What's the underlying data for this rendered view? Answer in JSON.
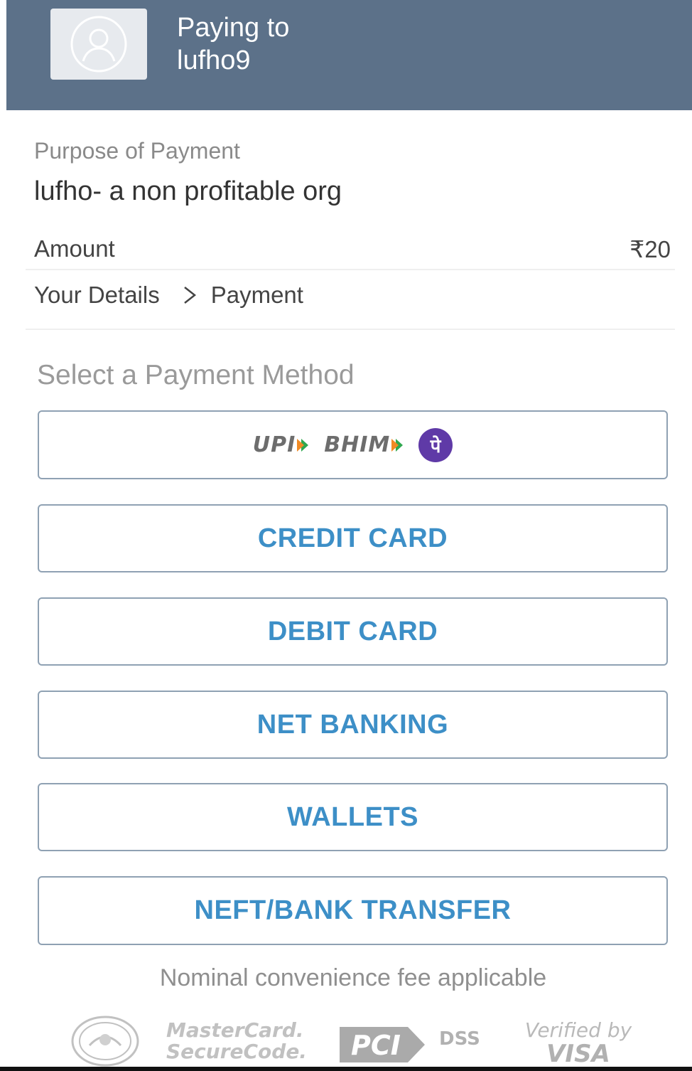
{
  "header": {
    "paying_to_label": "Paying to",
    "payee": "lufho9"
  },
  "purpose": {
    "label": "Purpose of Payment",
    "value": "lufho- a non profitable org"
  },
  "amount": {
    "label": "Amount",
    "value": "₹20"
  },
  "breadcrumb": {
    "step1": "Your Details",
    "step2": "Payment"
  },
  "methods": {
    "heading": "Select a Payment Method",
    "upi": {
      "upi_logo": "UPI",
      "bhim_logo": "BHIM",
      "phonepe_glyph": "पे"
    },
    "credit_card": "CREDIT CARD",
    "debit_card": "DEBIT CARD",
    "net_banking": "NET BANKING",
    "wallets": "WALLETS",
    "neft": "NEFT/BANK TRANSFER"
  },
  "fee_note": "Nominal convenience fee applicable",
  "trust_badges": {
    "mastercard_line1": "MasterCard.",
    "mastercard_line2": "SecureCode.",
    "pci": "PCI",
    "dss": "DSS",
    "verified_by": "Verified by",
    "visa": "VISA"
  },
  "colors": {
    "header_bg": "#5c7189",
    "button_text": "#3d8fc7",
    "button_border": "#8fa1b3",
    "phonepe": "#5f3aa7"
  }
}
